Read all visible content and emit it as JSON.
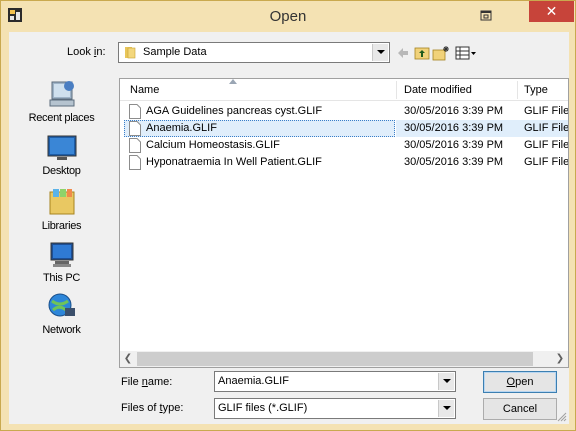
{
  "window": {
    "title": "Open",
    "close_glyph": "✕"
  },
  "lookin": {
    "label_pre": "Look ",
    "label_u": "i",
    "label_post": "n:",
    "value": "Sample Data"
  },
  "places": [
    {
      "label": "Recent places",
      "icon": "recent-places-icon"
    },
    {
      "label": "Desktop",
      "icon": "desktop-icon"
    },
    {
      "label": "Libraries",
      "icon": "libraries-icon"
    },
    {
      "label": "This PC",
      "icon": "this-pc-icon"
    },
    {
      "label": "Network",
      "icon": "network-icon"
    }
  ],
  "columns": {
    "name": "Name",
    "date": "Date modified",
    "type": "Type"
  },
  "files": [
    {
      "name": "AGA Guidelines pancreas cyst.GLIF",
      "date": "30/05/2016 3:39 PM",
      "type": "GLIF File"
    },
    {
      "name": "Anaemia.GLIF",
      "date": "30/05/2016 3:39 PM",
      "type": "GLIF File"
    },
    {
      "name": "Calcium Homeostasis.GLIF",
      "date": "30/05/2016 3:39 PM",
      "type": "GLIF File"
    },
    {
      "name": "Hyponatraemia In Well Patient.GLIF",
      "date": "30/05/2016 3:39 PM",
      "type": "GLIF File"
    }
  ],
  "filename": {
    "label_pre": "File ",
    "label_u": "n",
    "label_post": "ame:",
    "value": "Anaemia.GLIF"
  },
  "filetype": {
    "label_pre": "Files of ",
    "label_u": "t",
    "label_post": "ype:",
    "value": "GLIF files (*.GLIF)"
  },
  "buttons": {
    "open_u": "O",
    "open_rest": "pen",
    "cancel": "Cancel"
  },
  "colors": {
    "frame": "#f4e2b3",
    "close": "#c7443a",
    "selection": "#e0eefb",
    "default_button": "#3c7fb1"
  }
}
